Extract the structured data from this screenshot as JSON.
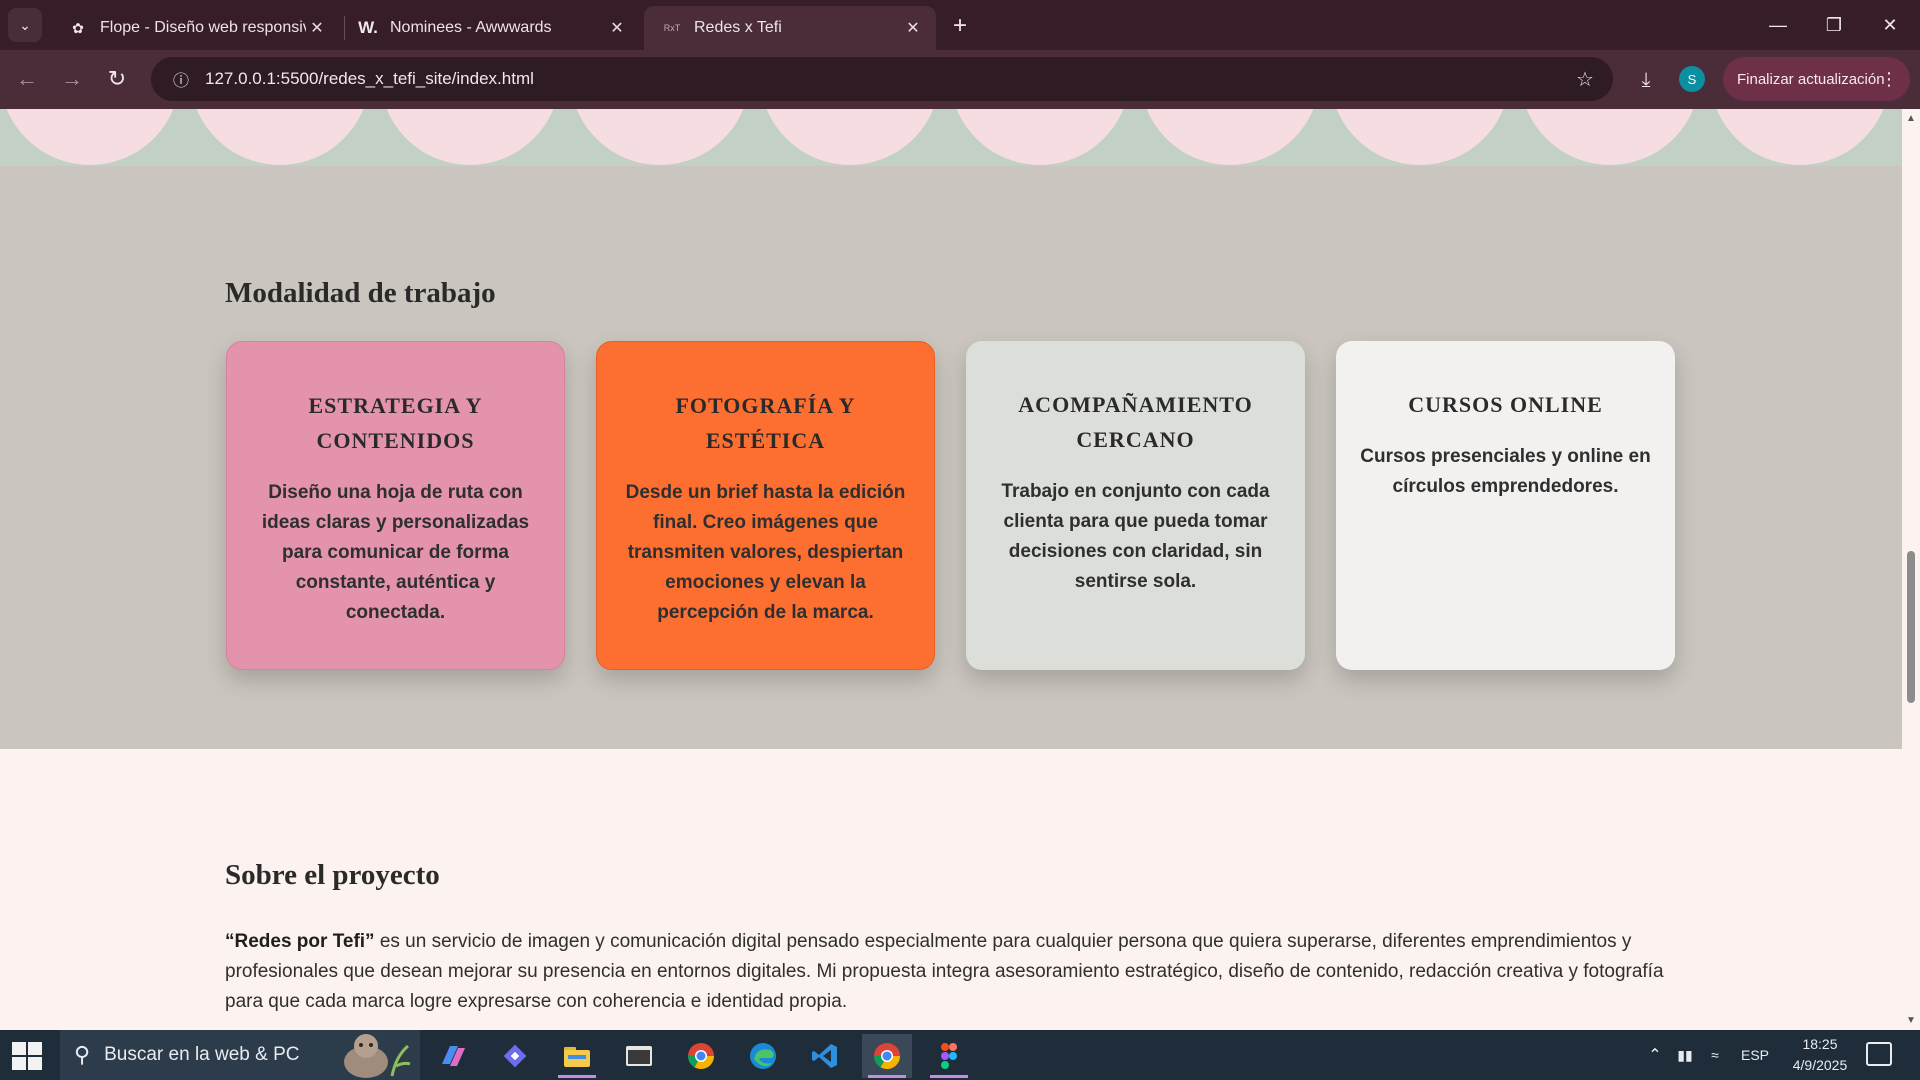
{
  "browser": {
    "tabs": [
      {
        "title": "Flope - Diseño web responsive",
        "icon": "openai-icon"
      },
      {
        "title": "Nominees - Awwwards",
        "icon": "awwwards-icon"
      },
      {
        "title": "Redes x Tefi",
        "icon": "rxt-favicon"
      }
    ],
    "url": "127.0.0.1:5500/redes_x_tefi_site/index.html",
    "profile_initial": "S",
    "update_label": "Finalizar actualización"
  },
  "colors": {
    "card_pink": "#e393ac",
    "card_orange": "#fd6e31",
    "card_gray": "#dcdfd9",
    "card_white": "#f2f1ef",
    "section_bg": "#cac5be",
    "band_green": "#c2d0c6",
    "band_pink": "#f6dde1"
  },
  "modalidad": {
    "title": "Modalidad de trabajo",
    "cards": [
      {
        "title": "ESTRATEGIA Y CONTENIDOS",
        "text": "Diseño una hoja de ruta con ideas claras y personalizadas para comunicar de forma constante, auténtica y conectada."
      },
      {
        "title": "FOTOGRAFÍA Y ESTÉTICA",
        "text": "Desde un brief hasta la edición final. Creo imágenes que transmiten valores, despiertan emociones y elevan la percepción de la marca."
      },
      {
        "title": "ACOMPAÑAMIENTO CERCANO",
        "text": "Trabajo en conjunto con cada clienta para que pueda tomar decisiones con claridad, sin sentirse sola."
      },
      {
        "title": "CURSOS ONLINE",
        "text": "Cursos presenciales y online en círculos emprendedores."
      }
    ]
  },
  "proyecto": {
    "title": "Sobre el proyecto",
    "brand": "“Redes por Tefi”",
    "text": " es un servicio de imagen y comunicación digital pensado especialmente para cualquier persona que quiera superarse, diferentes emprendimientos y profesionales que desean mejorar su presencia en entornos digitales. Mi propuesta integra asesoramiento estratégico, diseño de contenido, redacción creativa y fotografía para que cada marca logre expresarse con coherencia e identidad propia."
  },
  "taskbar": {
    "search_placeholder": "Buscar en la web & PC",
    "language": "ESP",
    "time": "18:25",
    "date": "4/9/2025"
  }
}
